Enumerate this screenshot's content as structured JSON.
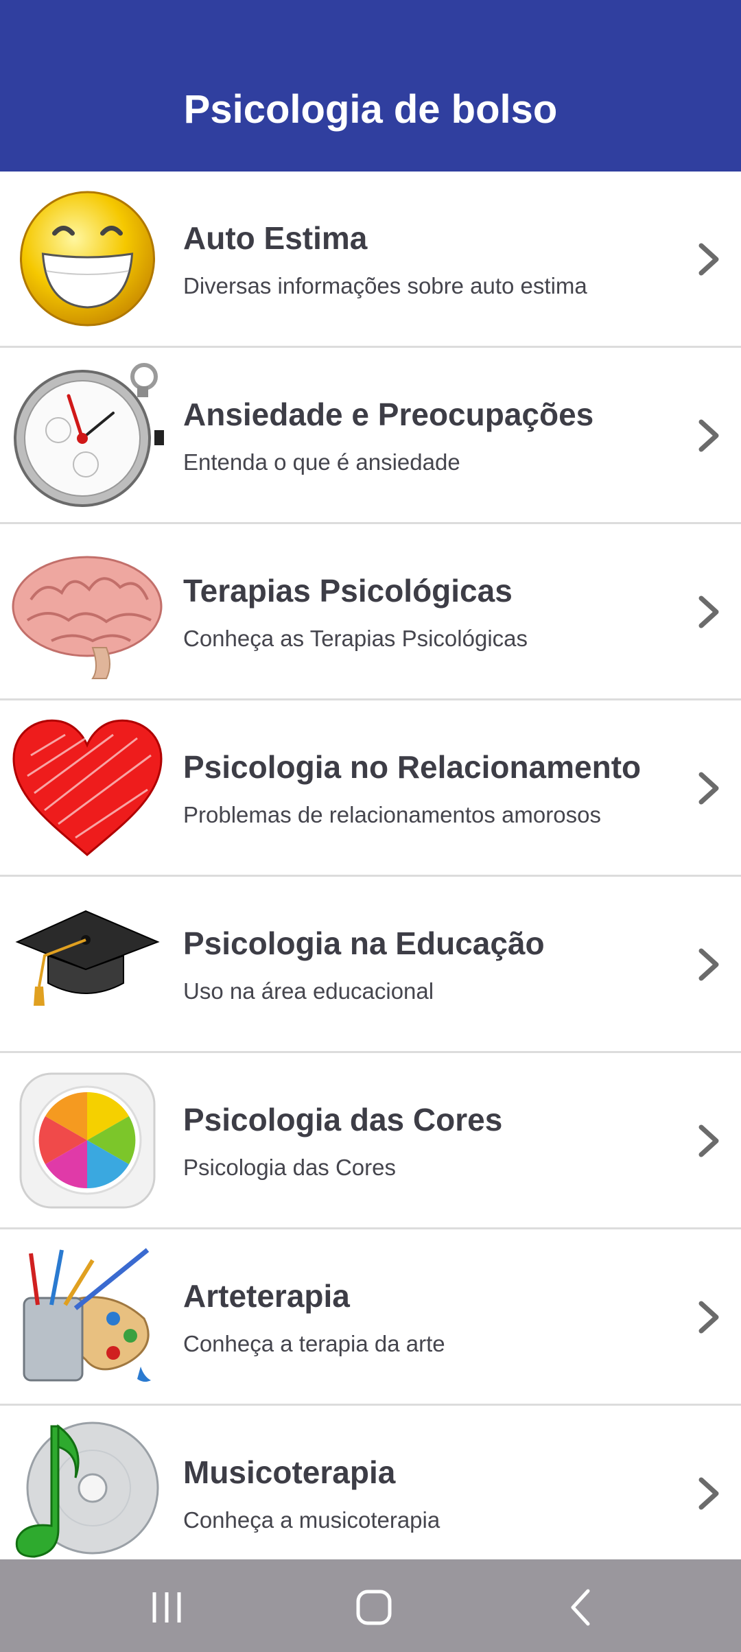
{
  "app_bar": {
    "title": "Psicologia de bolso",
    "color": "#303f9f"
  },
  "items": [
    {
      "title": "Auto Estima",
      "subtitle": "Diversas informações sobre auto estima",
      "icon": "smiley-icon"
    },
    {
      "title": "Ansiedade e Preocupações",
      "subtitle": "Entenda o que é ansiedade",
      "icon": "stopwatch-icon"
    },
    {
      "title": "Terapias Psicológicas",
      "subtitle": "Conheça as Terapias Psicológicas",
      "icon": "brain-icon"
    },
    {
      "title": "Psicologia no Relacionamento",
      "subtitle": "Problemas de relacionamentos amorosos",
      "icon": "heart-icon"
    },
    {
      "title": "Psicologia na Educação",
      "subtitle": "Uso na área educacional",
      "icon": "graduation-cap-icon"
    },
    {
      "title": "Psicologia das Cores",
      "subtitle": "Psicologia das Cores",
      "icon": "color-wheel-icon"
    },
    {
      "title": "Arteterapia",
      "subtitle": "Conheça a terapia da arte",
      "icon": "paint-palette-icon"
    },
    {
      "title": "Musicoterapia",
      "subtitle": "Conheça a musicoterapia",
      "icon": "music-disc-icon"
    }
  ],
  "nav_bar": {
    "buttons": [
      "recent-apps-icon",
      "home-icon",
      "back-icon"
    ],
    "color": "#9a979d"
  }
}
